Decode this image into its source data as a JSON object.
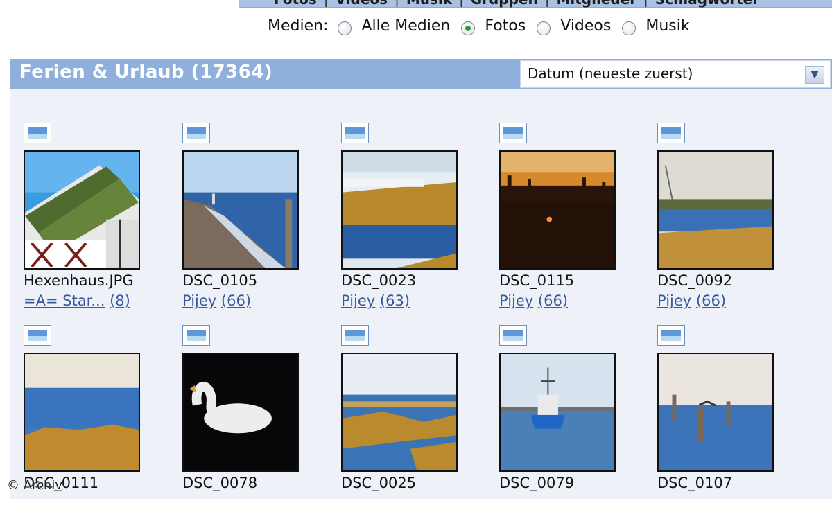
{
  "topnav": {
    "items": [
      "Fotos",
      "Videos",
      "Musik",
      "Gruppen",
      "Mitglieder",
      "Schlagwörter"
    ]
  },
  "media_filter": {
    "label": "Medien:",
    "options": [
      {
        "label": "Alle Medien",
        "checked": false
      },
      {
        "label": "Fotos",
        "checked": true
      },
      {
        "label": "Videos",
        "checked": false
      },
      {
        "label": "Musik",
        "checked": false
      }
    ]
  },
  "album": {
    "title": "Ferien & Urlaub (17364)",
    "sort_selected": "Datum (neueste zuerst)"
  },
  "photos": [
    {
      "name": "Hexenhaus.JPG",
      "owner": "=A= Star...",
      "count": "(8)",
      "scene": "house"
    },
    {
      "name": "DSC_0105",
      "owner": "Pijey",
      "count": "(66)",
      "scene": "beach"
    },
    {
      "name": "DSC_0023",
      "owner": "Pijey",
      "count": "(63)",
      "scene": "marsh"
    },
    {
      "name": "DSC_0115",
      "owner": "Pijey",
      "count": "(66)",
      "scene": "sunset"
    },
    {
      "name": "DSC_0092",
      "owner": "Pijey",
      "count": "(66)",
      "scene": "lake"
    },
    {
      "name": "DSC_0111",
      "owner": "",
      "count": "",
      "scene": "reeds"
    },
    {
      "name": "DSC_0078",
      "owner": "",
      "count": "",
      "scene": "swan"
    },
    {
      "name": "DSC_0025",
      "owner": "",
      "count": "",
      "scene": "lagoon"
    },
    {
      "name": "DSC_0079",
      "owner": "",
      "count": "",
      "scene": "boat"
    },
    {
      "name": "DSC_0107",
      "owner": "",
      "count": "",
      "scene": "posts"
    }
  ],
  "watermark": "© Archiv",
  "colors": {
    "album_bar": "#8fb0dc",
    "content_bg": "#eef1f8",
    "link": "#3a5a9c",
    "radio_checked": "#2f9a3e"
  }
}
